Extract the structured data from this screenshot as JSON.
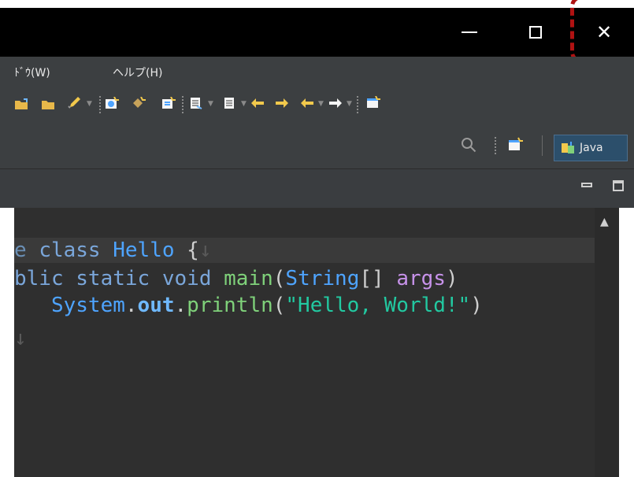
{
  "window": {
    "title": "",
    "minimize_icon": "minimize-icon",
    "maximize_icon": "maximize-icon",
    "close_icon": "close-icon",
    "close_glyph": "✕",
    "highlight_color": "#b01212"
  },
  "menubar": {
    "items": [
      {
        "label": "ﾄﾞｳ(W)"
      },
      {
        "label": "ヘルプ(H)"
      }
    ]
  },
  "toolbar": {
    "icons": [
      "open-folder-icon",
      "open-folder-icon",
      "brush-icon",
      "new-class-icon",
      "new-package-icon",
      "new-file-icon",
      "toggle-icon",
      "annotation-icon",
      "back-icon",
      "forward-icon",
      "nav-back-icon",
      "nav-forward-icon",
      "open-perspective-icon"
    ]
  },
  "perspective": {
    "search_icon": "search-icon",
    "open_perspective_icon": "open-perspective-icon",
    "label": "Java"
  },
  "view": {
    "minimize_icon": "view-minimize-icon",
    "maximize_icon": "view-maximize-icon"
  },
  "editor": {
    "lines": [
      {
        "parts": [
          {
            "t": "e ",
            "c": "#6a8fb5"
          },
          {
            "t": "class ",
            "c": "#7aa6da"
          },
          {
            "t": "Hello",
            "c": "#4ea4ff"
          },
          {
            "t": " {",
            "c": "#cfcfcf"
          },
          {
            "t": "↓",
            "c": "#5a5a5a"
          }
        ]
      },
      {
        "parts": [
          {
            "t": "blic ",
            "c": "#7aa6da"
          },
          {
            "t": "static ",
            "c": "#7aa6da"
          },
          {
            "t": "void ",
            "c": "#7aa6da"
          },
          {
            "t": "main",
            "c": "#7fd17a"
          },
          {
            "t": "(",
            "c": "#cfcfcf"
          },
          {
            "t": "String",
            "c": "#4ea4ff"
          },
          {
            "t": "[] ",
            "c": "#cfcfcf"
          },
          {
            "t": "args",
            "c": "#c792ea"
          },
          {
            "t": ")",
            "c": "#cfcfcf"
          }
        ]
      },
      {
        "parts": [
          {
            "t": "   System",
            "c": "#4ea4ff"
          },
          {
            "t": ".",
            "c": "#cfcfcf"
          },
          {
            "t": "out",
            "c": "#6fb8ff",
            "b": true
          },
          {
            "t": ".",
            "c": "#cfcfcf"
          },
          {
            "t": "println",
            "c": "#7fd17a"
          },
          {
            "t": "(",
            "c": "#cfcfcf"
          },
          {
            "t": "\"Hello, World!\"",
            "c": "#22c9a1"
          },
          {
            "t": ")",
            "c": "#cfcfcf"
          }
        ]
      },
      {
        "parts": [
          {
            "t": "↓",
            "c": "#5a5a5a"
          }
        ]
      }
    ]
  },
  "colors": {
    "titlebar": "#000000",
    "menubar": "#3c3f41",
    "editor_bg": "#2f2f2f",
    "perspective_bg": "#2c4f6b"
  }
}
